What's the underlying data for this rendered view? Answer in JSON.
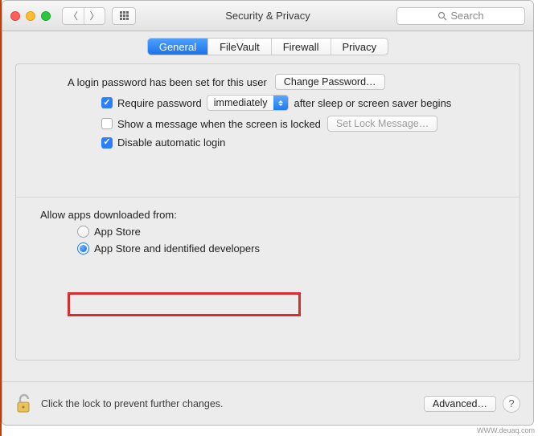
{
  "window": {
    "title": "Security & Privacy"
  },
  "search": {
    "placeholder": "Search"
  },
  "tabs": [
    "General",
    "FileVault",
    "Firewall",
    "Privacy"
  ],
  "active_tab": 0,
  "login": {
    "password_set_text": "A login password has been set for this user",
    "change_password_btn": "Change Password…"
  },
  "options": {
    "require_password": {
      "checked": true,
      "label_before": "Require password",
      "select_value": "immediately",
      "label_after": "after sleep or screen saver begins"
    },
    "show_message": {
      "checked": false,
      "label": "Show a message when the screen is locked",
      "btn": "Set Lock Message…",
      "btn_enabled": false
    },
    "disable_auto_login": {
      "checked": true,
      "label": "Disable automatic login"
    }
  },
  "downloads": {
    "heading": "Allow apps downloaded from:",
    "options": [
      "App Store",
      "App Store and identified developers"
    ],
    "selected": 1
  },
  "footer": {
    "lock_text": "Click the lock to prevent further changes.",
    "advanced_btn": "Advanced…"
  },
  "watermark": "WWW.deuaq.com"
}
